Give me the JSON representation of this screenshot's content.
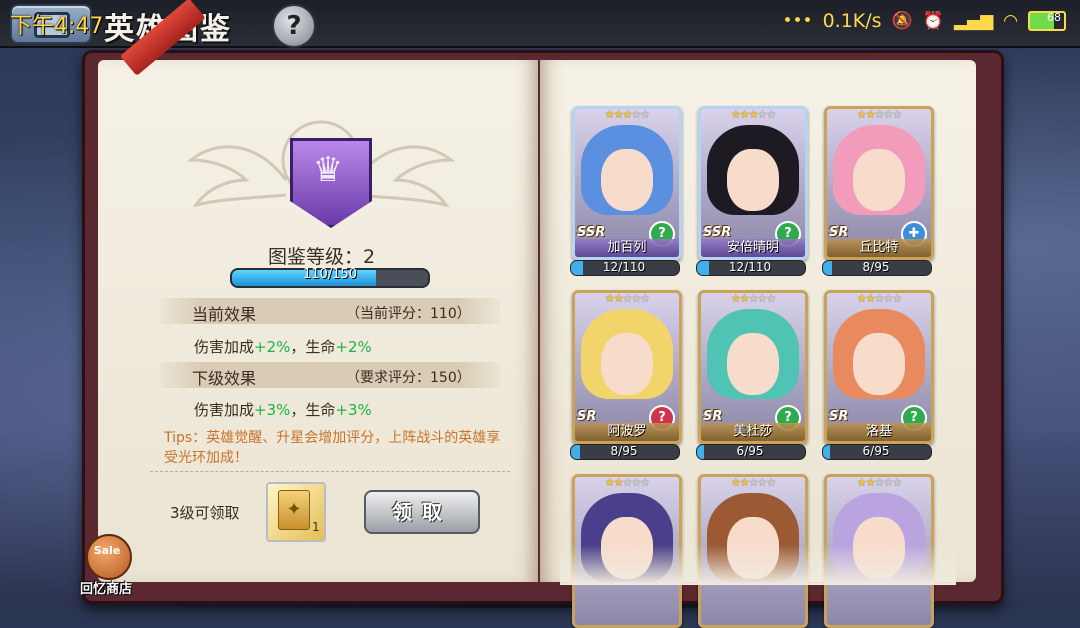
{
  "status_bar": {
    "time": "下午4:47",
    "network_speed": "0.1K/s",
    "battery_level": "68"
  },
  "header": {
    "title": "英雄图鉴",
    "help_label": "?"
  },
  "codex": {
    "level_label": "图鉴等级：2",
    "progress_text": "110/150",
    "progress_fraction": 0.733,
    "current_effect": {
      "title": "当前效果",
      "score_note": "（当前评分：110）",
      "line_prefix": "伤害加成",
      "damage_bonus": "+2%",
      "line_middle": "，生命",
      "hp_bonus": "+2%"
    },
    "next_effect": {
      "title": "下级效果",
      "score_note": "（要求评分：150）",
      "line_prefix": "伤害加成",
      "damage_bonus": "+3%",
      "line_middle": "，生命",
      "hp_bonus": "+3%"
    },
    "tips": "Tips：英雄觉醒、升星会增加评分，上阵战斗的英雄享受光环加成！",
    "claim_label": "3级可领取",
    "reward_count": "1",
    "claim_button": "领取"
  },
  "shop": {
    "badge": "Sale",
    "label": "回忆商店"
  },
  "colors": {
    "accent_green": "#1fb24a",
    "tips_orange": "#c8732a",
    "progress_blue": "#3fb0ea"
  },
  "heroes": [
    {
      "name": "加百列",
      "rank": "SSR",
      "stars": 3,
      "progress": "12/110",
      "fraction": 0.11,
      "class_icon": "question-icon",
      "hair": "#5b8fe0"
    },
    {
      "name": "安倍晴明",
      "rank": "SSR",
      "stars": 3,
      "progress": "12/110",
      "fraction": 0.11,
      "class_icon": "question-icon",
      "hair": "#1d1a24"
    },
    {
      "name": "丘比特",
      "rank": "SR",
      "stars": 2,
      "progress": "8/95",
      "fraction": 0.084,
      "class_icon": "cross-icon",
      "hair": "#f29bbb"
    },
    {
      "name": "阿波罗",
      "rank": "SR",
      "stars": 2,
      "progress": "8/95",
      "fraction": 0.084,
      "class_icon": "question-icon",
      "hair": "#f2d56a"
    },
    {
      "name": "美杜莎",
      "rank": "SR",
      "stars": 2,
      "progress": "6/95",
      "fraction": 0.063,
      "class_icon": "question-icon",
      "hair": "#4fc3b4"
    },
    {
      "name": "洛基",
      "rank": "SR",
      "stars": 2,
      "progress": "6/95",
      "fraction": 0.063,
      "class_icon": "question-icon",
      "hair": "#e98a5e"
    },
    {
      "name": "",
      "rank": "",
      "stars": 2,
      "progress": "",
      "fraction": 0,
      "class_icon": "",
      "hair": "#4a3f8a"
    },
    {
      "name": "",
      "rank": "",
      "stars": 2,
      "progress": "",
      "fraction": 0,
      "class_icon": "",
      "hair": "#9b5a34"
    },
    {
      "name": "",
      "rank": "",
      "stars": 2,
      "progress": "",
      "fraction": 0,
      "class_icon": "",
      "hair": "#b9a4e0"
    }
  ]
}
